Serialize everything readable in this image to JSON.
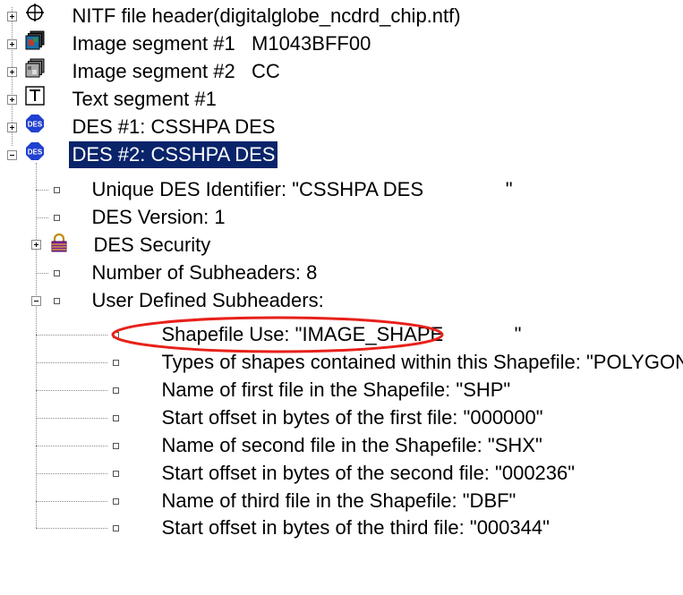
{
  "tree": {
    "root_items": [
      {
        "label": "NITF file header(digitalglobe_ncdrd_chip.ntf)",
        "icon": "crosshair-icon",
        "expanded": false
      },
      {
        "label": "Image segment #1   M1043BFF00",
        "icon": "image-segment-color-icon",
        "expanded": false
      },
      {
        "label": "Image segment #2   CC",
        "icon": "image-segment-gray-icon",
        "expanded": false
      },
      {
        "label": "Text segment #1",
        "icon": "text-segment-icon",
        "expanded": false
      },
      {
        "label": "DES #1: CSSHPA DES",
        "icon": "des-icon",
        "expanded": false
      },
      {
        "label": "DES #2: CSSHPA DES",
        "icon": "des-icon",
        "expanded": true,
        "selected": true
      }
    ],
    "des2_children": [
      {
        "label": "Unique DES Identifier: \"CSSHPA DES               \""
      },
      {
        "label": "DES Version: 1"
      },
      {
        "label": "DES Security",
        "icon": "lock-icon",
        "expanded": false
      },
      {
        "label": "Number of Subheaders: 8"
      },
      {
        "label": "User Defined Subheaders:",
        "expanded": true
      }
    ],
    "user_defined_children": [
      {
        "label": "Shapefile Use: \"IMAGE_SHAPE             \"",
        "highlighted": true
      },
      {
        "label": "Types of shapes contained within this Shapefile: \"POLYGON   \""
      },
      {
        "label": "Name of first file in the Shapefile: \"SHP\""
      },
      {
        "label": "Start offset in bytes of the first file: \"000000\""
      },
      {
        "label": "Name of second file in the Shapefile: \"SHX\""
      },
      {
        "label": "Start offset in bytes of the second file: \"000236\""
      },
      {
        "label": "Name of third file in the Shapefile: \"DBF\""
      },
      {
        "label": "Start offset in bytes of the third file: \"000344\""
      }
    ]
  },
  "colors": {
    "selection": "#0a246a",
    "highlight_ellipse": "#e8201a",
    "des_icon": "#2040d0"
  }
}
